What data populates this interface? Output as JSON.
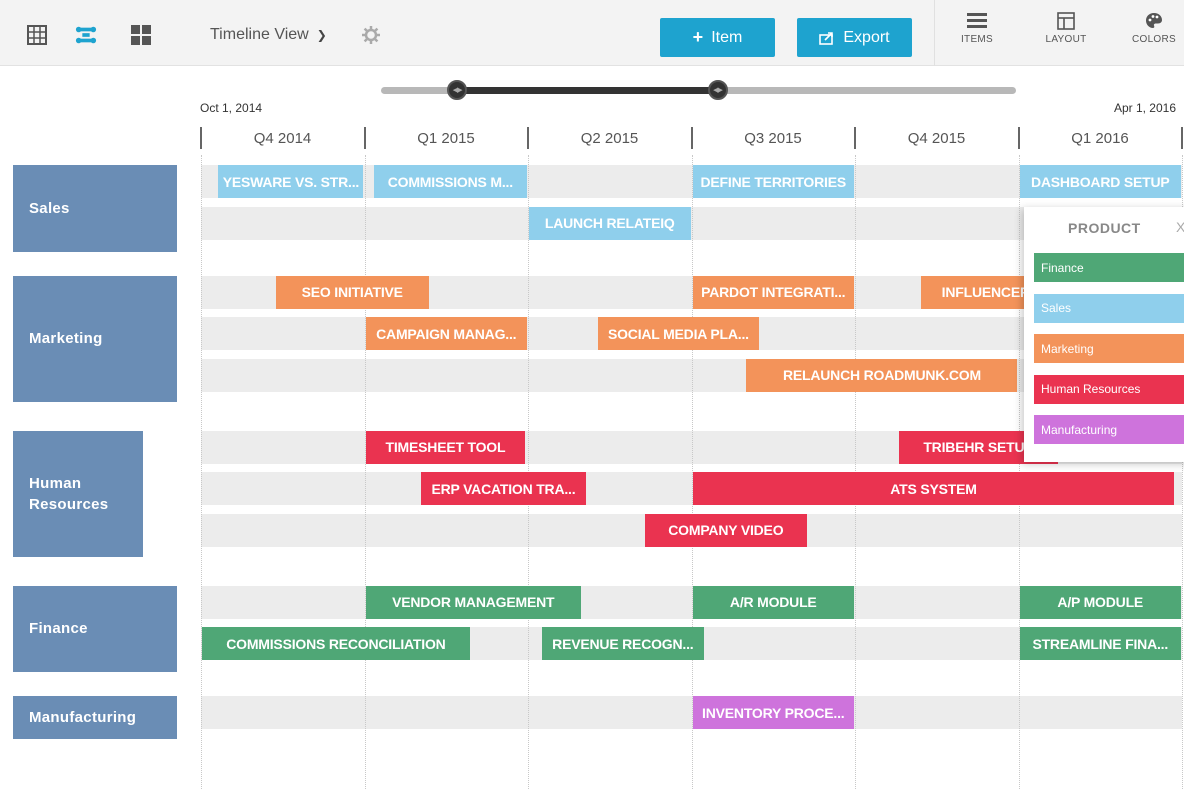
{
  "toolbar": {
    "view_name": "Timeline View",
    "item_button": "Item",
    "export_button": "Export",
    "tools": {
      "items": "ITEMS",
      "layout": "LAYOUT",
      "colors": "COLORS"
    },
    "accent_color": "#1ea3cf",
    "icons": [
      "table-view-icon",
      "timeline-view-icon",
      "board-view-icon",
      "chevron-down-icon",
      "gear-icon",
      "plus-icon",
      "export-icon",
      "items-list-icon",
      "layout-icon",
      "palette-icon"
    ]
  },
  "timeline": {
    "start_date": "Oct 1, 2014",
    "end_date": "Apr 1, 2016",
    "quarters": [
      "Q4 2014",
      "Q1 2015",
      "Q2 2015",
      "Q3 2015",
      "Q4 2015",
      "Q1 2016"
    ],
    "visible_window_fraction": {
      "start": 0.12,
      "end": 0.53
    }
  },
  "groups": [
    {
      "name": "Sales",
      "color_key": "sales",
      "rows": [
        [
          {
            "label": "YESWARE VS. STR...",
            "start": 0.1,
            "end": 1.0
          },
          {
            "label": "COMMISSIONS M...",
            "start": 1.05,
            "end": 2.0
          },
          {
            "label": "DEFINE TERRITORIES",
            "start": 3.0,
            "end": 4.0
          },
          {
            "label": "DASHBOARD SETUP",
            "start": 5.0,
            "end": 6.0
          }
        ],
        [
          {
            "label": "LAUNCH RELATEIQ",
            "start": 2.0,
            "end": 3.0
          }
        ]
      ]
    },
    {
      "name": "Marketing",
      "color_key": "marketing",
      "rows": [
        [
          {
            "label": "SEO INITIATIVE",
            "start": 0.45,
            "end": 1.4
          },
          {
            "label": "PARDOT INTEGRATI...",
            "start": 3.0,
            "end": 4.0
          },
          {
            "label": "INFLUENCER",
            "start": 4.4,
            "end": 5.2
          }
        ],
        [
          {
            "label": "CAMPAIGN MANAG...",
            "start": 1.0,
            "end": 2.0
          },
          {
            "label": "SOCIAL MEDIA PLA...",
            "start": 2.42,
            "end": 3.42
          }
        ],
        [
          {
            "label": "RELAUNCH ROADMUNK.COM",
            "start": 3.33,
            "end": 5.0
          }
        ]
      ]
    },
    {
      "name": "Human Resources",
      "color_key": "hr",
      "rows": [
        [
          {
            "label": "TIMESHEET TOOL",
            "start": 1.0,
            "end": 1.99
          },
          {
            "label": "TRIBEHR SETUP",
            "start": 4.26,
            "end": 5.25
          }
        ],
        [
          {
            "label": "ERP VACATION TRA...",
            "start": 1.34,
            "end": 2.36
          },
          {
            "label": "ATS SYSTEM",
            "start": 3.0,
            "end": 5.96
          }
        ],
        [
          {
            "label": "COMPANY VIDEO",
            "start": 2.71,
            "end": 3.71
          }
        ]
      ]
    },
    {
      "name": "Finance",
      "color_key": "finance",
      "rows": [
        [
          {
            "label": "VENDOR MANAGEMENT",
            "start": 1.0,
            "end": 2.33
          },
          {
            "label": "A/R MODULE",
            "start": 3.0,
            "end": 4.0
          },
          {
            "label": "A/P MODULE",
            "start": 5.0,
            "end": 6.0
          }
        ],
        [
          {
            "label": "COMMISSIONS RECONCILIATION",
            "start": 0.0,
            "end": 1.65
          },
          {
            "label": "REVENUE RECOGN...",
            "start": 2.08,
            "end": 3.08
          },
          {
            "label": "STREAMLINE FINA...",
            "start": 5.0,
            "end": 6.0
          }
        ]
      ]
    },
    {
      "name": "Manufacturing",
      "color_key": "mfg",
      "rows": [
        [
          {
            "label": "INVENTORY PROCE...",
            "start": 3.0,
            "end": 4.0
          }
        ]
      ]
    }
  ],
  "legend": {
    "title": "PRODUCT",
    "close": "X",
    "items": [
      {
        "label": "Finance",
        "color": "#4fa776"
      },
      {
        "label": "Sales",
        "color": "#8fcfec"
      },
      {
        "label": "Marketing",
        "color": "#f3935a"
      },
      {
        "label": "Human Resources",
        "color": "#ea3350"
      },
      {
        "label": "Manufacturing",
        "color": "#ce73dc"
      }
    ]
  }
}
